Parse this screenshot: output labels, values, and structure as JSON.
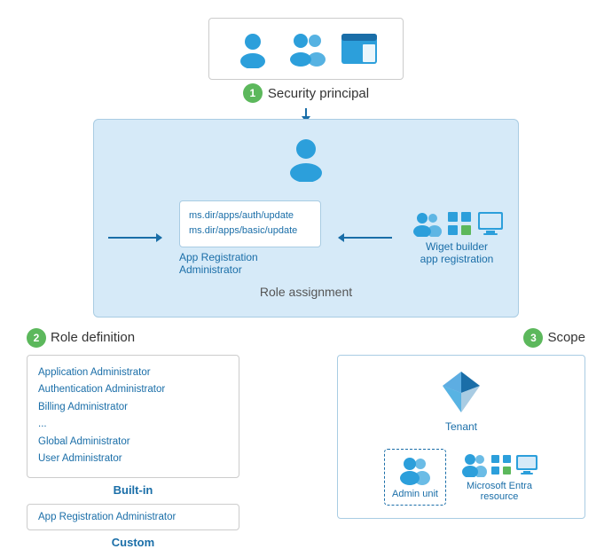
{
  "security_principal": {
    "label": "Security principal",
    "num": "1"
  },
  "role_assignment": {
    "label": "Role assignment",
    "role_def_box_lines": [
      "ms.dir/apps/auth/update",
      "ms.dir/apps/basic/update"
    ],
    "app_reg_admin_label": "App Registration Administrator",
    "widget_builder_label": "Wiget builder\napp registration"
  },
  "role_definition": {
    "label": "Role definition",
    "num": "2",
    "builtin_roles": [
      "Application Administrator",
      "Authentication Administrator",
      "Billing Administrator",
      "...",
      "Global Administrator",
      "User Administrator"
    ],
    "builtin_label": "Built-in",
    "custom_role": "App Registration Administrator",
    "custom_label": "Custom"
  },
  "scope": {
    "label": "Scope",
    "num": "3",
    "tenant_label": "Tenant",
    "admin_unit_label": "Admin unit",
    "ms_entra_label": "Microsoft Entra\nresource"
  }
}
